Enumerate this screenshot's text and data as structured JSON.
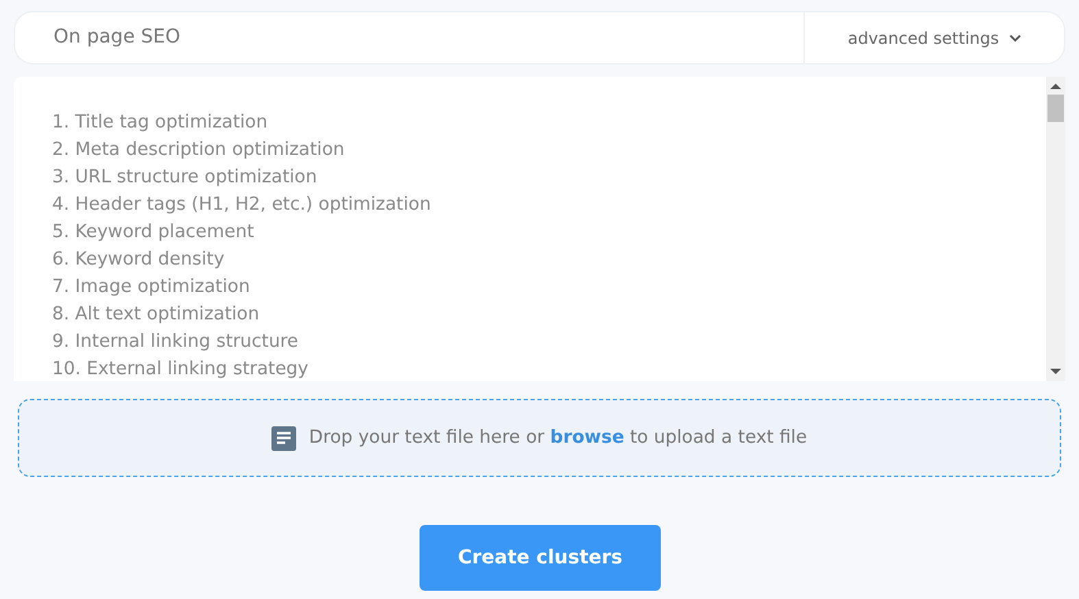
{
  "header": {
    "value": "On page SEO",
    "settings_label": "advanced settings"
  },
  "keywords": [
    "1. Title tag optimization",
    "2. Meta description optimization",
    "3. URL structure optimization",
    "4. Header tags (H1, H2, etc.) optimization",
    "5. Keyword placement",
    "6. Keyword density",
    "7. Image optimization",
    "8. Alt text optimization",
    "9. Internal linking structure",
    "10. External linking strategy"
  ],
  "dropzone": {
    "before": "Drop your text file here or",
    "link": "browse",
    "after": "to upload a text file"
  },
  "submit_button": "Create clusters"
}
